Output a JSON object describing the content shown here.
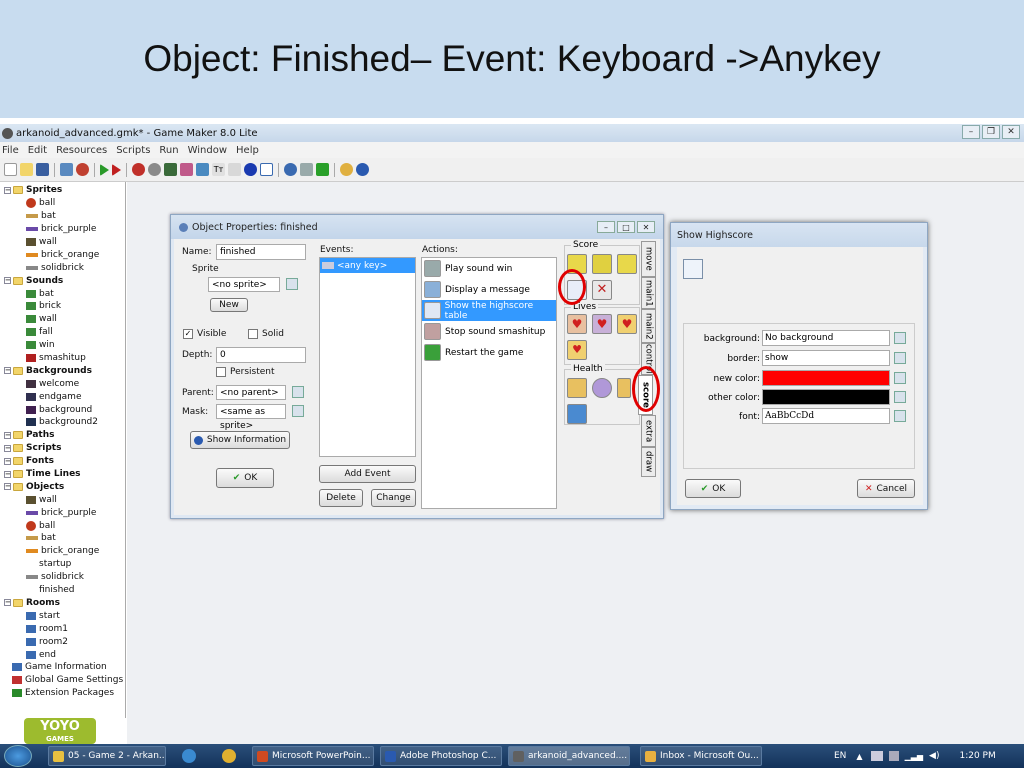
{
  "slide": {
    "title": "Object: Finished– Event: Keyboard ->Anykey"
  },
  "app": {
    "title": "arkanoid_advanced.gmk* - Game Maker 8.0 Lite",
    "menu": [
      "File",
      "Edit",
      "Resources",
      "Scripts",
      "Run",
      "Window",
      "Help"
    ]
  },
  "tree": [
    {
      "label": "Sprites",
      "type": "category",
      "icon": "folder-icon"
    },
    {
      "label": "ball",
      "type": "item",
      "icon": "ball-icon",
      "color": "#c0391c"
    },
    {
      "label": "bat",
      "type": "item",
      "icon": "bat-icon",
      "color": "#c59a4a"
    },
    {
      "label": "brick_purple",
      "type": "item",
      "icon": "brick-icon",
      "color": "#6a4aa8"
    },
    {
      "label": "wall",
      "type": "item",
      "icon": "wall-icon",
      "color": "#5a5030"
    },
    {
      "label": "brick_orange",
      "type": "item",
      "icon": "brick-icon",
      "color": "#e08a20"
    },
    {
      "label": "solidbrick",
      "type": "item",
      "icon": "brick-icon",
      "color": "#888888"
    },
    {
      "label": "Sounds",
      "type": "category",
      "icon": "folder-icon"
    },
    {
      "label": "bat",
      "type": "item",
      "icon": "sound-icon",
      "color": "#3a8a3a"
    },
    {
      "label": "brick",
      "type": "item",
      "icon": "sound-icon",
      "color": "#3a8a3a"
    },
    {
      "label": "wall",
      "type": "item",
      "icon": "sound-icon",
      "color": "#3a8a3a"
    },
    {
      "label": "fall",
      "type": "item",
      "icon": "sound-icon",
      "color": "#3a8a3a"
    },
    {
      "label": "win",
      "type": "item",
      "icon": "sound-icon",
      "color": "#3a8a3a"
    },
    {
      "label": "smashitup",
      "type": "item",
      "icon": "sound-icon",
      "color": "#b02020"
    },
    {
      "label": "Backgrounds",
      "type": "category",
      "icon": "folder-icon"
    },
    {
      "label": "welcome",
      "type": "item",
      "icon": "background-icon",
      "color": "#403040"
    },
    {
      "label": "endgame",
      "type": "item",
      "icon": "background-icon",
      "color": "#303050"
    },
    {
      "label": "background",
      "type": "item",
      "icon": "background-icon",
      "color": "#402050"
    },
    {
      "label": "background2",
      "type": "item",
      "icon": "background-icon",
      "color": "#203050"
    },
    {
      "label": "Paths",
      "type": "category",
      "icon": "folder-icon"
    },
    {
      "label": "Scripts",
      "type": "category",
      "icon": "folder-icon"
    },
    {
      "label": "Fonts",
      "type": "category",
      "icon": "folder-icon"
    },
    {
      "label": "Time Lines",
      "type": "category",
      "icon": "folder-icon"
    },
    {
      "label": "Objects",
      "type": "category",
      "icon": "folder-icon"
    },
    {
      "label": "wall",
      "type": "item",
      "icon": "wall-icon",
      "color": "#5a5030"
    },
    {
      "label": "brick_purple",
      "type": "item",
      "icon": "brick-icon",
      "color": "#6a4aa8"
    },
    {
      "label": "ball",
      "type": "item",
      "icon": "ball-icon",
      "color": "#c0391c"
    },
    {
      "label": "bat",
      "type": "item",
      "icon": "bat-icon",
      "color": "#c59a4a"
    },
    {
      "label": "brick_orange",
      "type": "item",
      "icon": "brick-icon",
      "color": "#e08a20"
    },
    {
      "label": "startup",
      "type": "item",
      "icon": "none",
      "color": ""
    },
    {
      "label": "solidbrick",
      "type": "item",
      "icon": "brick-icon",
      "color": "#888888"
    },
    {
      "label": "finished",
      "type": "item",
      "icon": "none",
      "color": ""
    },
    {
      "label": "Rooms",
      "type": "category",
      "icon": "folder-icon"
    },
    {
      "label": "start",
      "type": "item",
      "icon": "room-icon",
      "color": "#3a6ab0"
    },
    {
      "label": "room1",
      "type": "item",
      "icon": "room-icon",
      "color": "#3a6ab0"
    },
    {
      "label": "room2",
      "type": "item",
      "icon": "room-icon",
      "color": "#3a6ab0"
    },
    {
      "label": "end",
      "type": "item",
      "icon": "room-icon",
      "color": "#3a6ab0"
    },
    {
      "label": "Game Information",
      "type": "root",
      "icon": "info-icon",
      "color": "#3a6ab0"
    },
    {
      "label": "Global Game Settings",
      "type": "root",
      "icon": "settings-icon",
      "color": "#c03030"
    },
    {
      "label": "Extension Packages",
      "type": "root",
      "icon": "extension-icon",
      "color": "#2a8a2a"
    }
  ],
  "logo": {
    "text": "YOYO",
    "sub": "GAMES"
  },
  "object_window": {
    "title": "Object Properties: finished",
    "name_label": "Name:",
    "name_value": "finished",
    "sprite_label": "Sprite",
    "sprite_value": "<no sprite>",
    "new_button": "New",
    "visible_label": "Visible",
    "visible_checked": true,
    "solid_label": "Solid",
    "solid_checked": false,
    "depth_label": "Depth:",
    "depth_value": "0",
    "persistent_label": "Persistent",
    "persistent_checked": false,
    "parent_label": "Parent:",
    "parent_value": "<no parent>",
    "mask_label": "Mask:",
    "mask_value": "<same as sprite>",
    "show_info_button": "Show Information",
    "ok_button": "OK",
    "events_label": "Events:",
    "events": [
      "<any key>"
    ],
    "add_event_button": "Add Event",
    "delete_button": "Delete",
    "change_button": "Change",
    "actions_label": "Actions:",
    "actions": [
      {
        "label": "Play sound win",
        "selected": false,
        "icon": "speaker-icon"
      },
      {
        "label": "Display a message",
        "selected": false,
        "icon": "message-icon"
      },
      {
        "label": "Show the highscore table",
        "selected": true,
        "icon": "highscore-icon"
      },
      {
        "label": "Stop sound smashitup",
        "selected": false,
        "icon": "stop-sound-icon"
      },
      {
        "label": "Restart the game",
        "selected": false,
        "icon": "restart-icon"
      }
    ],
    "score_group": "Score",
    "lives_group": "Lives",
    "health_group": "Health",
    "tabs": [
      "move",
      "main1",
      "main2",
      "control",
      "score",
      "extra",
      "draw"
    ],
    "active_tab": "score"
  },
  "highscore_window": {
    "title": "Show Highscore",
    "background_label": "background:",
    "background_value": "No background",
    "border_label": "border:",
    "border_value": "show",
    "new_color_label": "new color:",
    "new_color": "#ff0000",
    "other_color_label": "other color:",
    "other_color": "#000000",
    "font_label": "font:",
    "font_value": "AaBbCcDd",
    "ok_button": "OK",
    "cancel_button": "Cancel"
  },
  "taskbar": {
    "tasks": [
      {
        "label": "05 - Game 2 - Arkan...",
        "color": "#e8c040"
      },
      {
        "label": "Microsoft PowerPoin...",
        "color": "#d04a20"
      },
      {
        "label": "Adobe Photoshop C...",
        "color": "#2a5ab0"
      },
      {
        "label": "arkanoid_advanced....",
        "color": "#606060"
      },
      {
        "label": "Inbox - Microsoft Ou...",
        "color": "#e8b040"
      }
    ],
    "lang": "EN",
    "time": "1:20 PM"
  }
}
